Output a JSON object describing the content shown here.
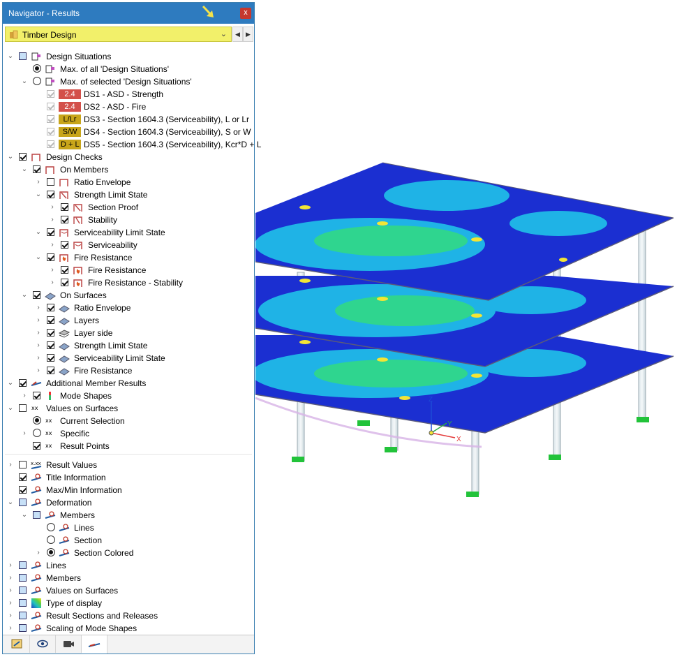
{
  "window": {
    "title": "Navigator - Results",
    "close_label": "x"
  },
  "combo": {
    "value": "Timber Design"
  },
  "tree": [
    {
      "label": "Design Situations"
    },
    {
      "label": "Max. of all 'Design Situations'"
    },
    {
      "label": "Max. of selected 'Design Situations'"
    },
    {
      "label": "DS1 - ASD - Strength",
      "badge": "2.4"
    },
    {
      "label": "DS2 - ASD - Fire",
      "badge": "2.4"
    },
    {
      "label": "DS3 - Section 1604.3 (Serviceability), L or Lr",
      "badge": "L/Lr"
    },
    {
      "label": "DS4 - Section 1604.3 (Serviceability), S or W",
      "badge": "S/W"
    },
    {
      "label": "DS5 - Section 1604.3 (Serviceability), Kcr*D + L",
      "badge": "D + L"
    },
    {
      "label": "Design Checks"
    },
    {
      "label": "On Members"
    },
    {
      "label": "Ratio Envelope"
    },
    {
      "label": "Strength Limit State"
    },
    {
      "label": "Section Proof"
    },
    {
      "label": "Stability"
    },
    {
      "label": "Serviceability Limit State"
    },
    {
      "label": "Serviceability"
    },
    {
      "label": "Fire Resistance"
    },
    {
      "label": "Fire Resistance"
    },
    {
      "label": "Fire Resistance - Stability"
    },
    {
      "label": "On Surfaces"
    },
    {
      "label": "Ratio Envelope"
    },
    {
      "label": "Layers"
    },
    {
      "label": "Layer side"
    },
    {
      "label": "Strength Limit State"
    },
    {
      "label": "Serviceability Limit State"
    },
    {
      "label": "Fire Resistance"
    },
    {
      "label": "Additional Member Results"
    },
    {
      "label": "Mode Shapes"
    },
    {
      "label": "Values on Surfaces"
    },
    {
      "label": "Current Selection"
    },
    {
      "label": "Specific"
    },
    {
      "label": "Result Points"
    },
    {
      "label": "Result Values"
    },
    {
      "label": "Title Information"
    },
    {
      "label": "Max/Min Information"
    },
    {
      "label": "Deformation"
    },
    {
      "label": "Members"
    },
    {
      "label": "Lines"
    },
    {
      "label": "Section"
    },
    {
      "label": "Section Colored"
    },
    {
      "label": "Lines"
    },
    {
      "label": "Members"
    },
    {
      "label": "Values on Surfaces"
    },
    {
      "label": "Type of display"
    },
    {
      "label": "Result Sections and Releases"
    },
    {
      "label": "Scaling of Mode Shapes"
    }
  ],
  "icon_labels": {
    "values_xx": "xx",
    "values_xxx": "x.xx"
  },
  "axes": {
    "x": "X",
    "y": "Y",
    "z": "Z"
  },
  "colors": {
    "title_bar": "#2e7bbf",
    "combo": "#f2f06a",
    "badge_red": "#d3504a",
    "badge_yellow": "#c8a51a"
  }
}
